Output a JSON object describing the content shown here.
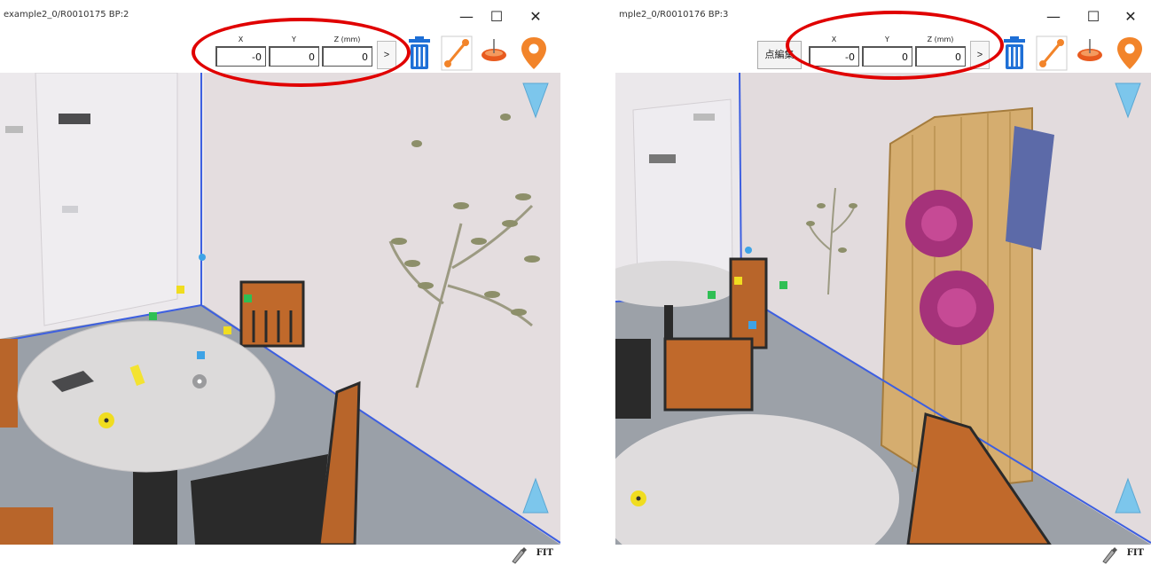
{
  "left": {
    "title": "example2_0/R0010175 BP:2",
    "coords": {
      "x_label": "X",
      "y_label": "Y",
      "z_label": "Z (mm)",
      "x": "-0",
      "y": "0",
      "z": "0"
    },
    "go_label": ">",
    "fit_label": "FIT"
  },
  "right": {
    "title": "mple2_0/R0010176 BP:3",
    "edit_label": "点編集",
    "coords": {
      "x_label": "X",
      "y_label": "Y",
      "z_label": "Z (mm)",
      "x": "-0",
      "y": "0",
      "z": "0"
    },
    "go_label": ">",
    "fit_label": "FIT"
  },
  "window_controls": {
    "minimize": "—",
    "maximize": "☐",
    "close": "✕"
  },
  "icons": [
    "trash-icon",
    "line-tool-icon",
    "plane-tool-icon",
    "location-pin-icon",
    "nav-down-icon",
    "nav-up-icon",
    "pen-icon"
  ],
  "colors": {
    "tool_blue": "#1e6fd6",
    "tool_orange": "#f2842a",
    "nav_arrow": "#7cc6ec",
    "annotation_red": "#e00000"
  }
}
